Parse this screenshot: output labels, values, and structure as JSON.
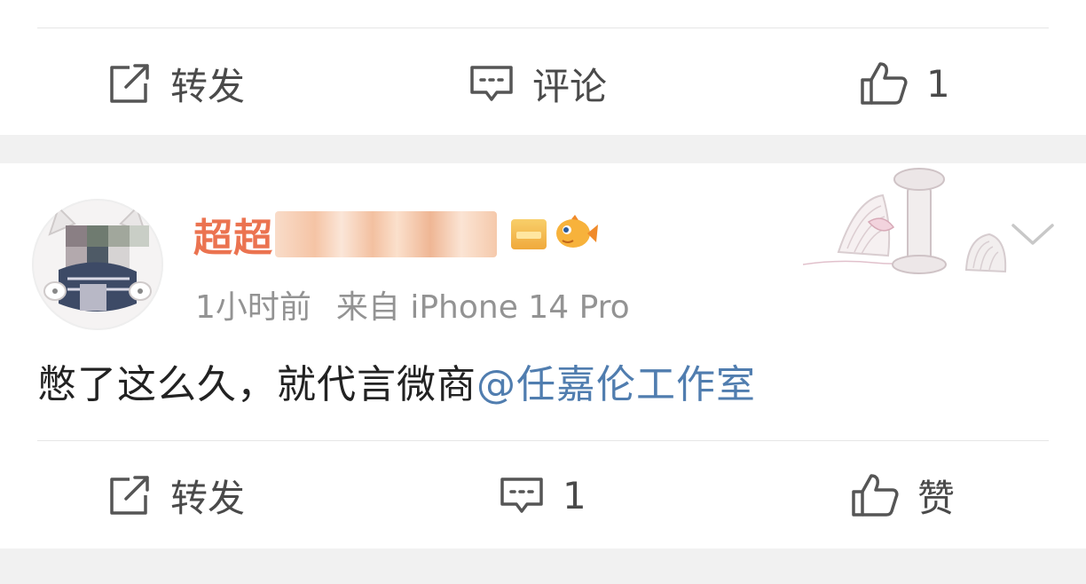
{
  "top_card": {
    "actions": {
      "repost_label": "转发",
      "comment_label": "评论",
      "like_count": "1"
    }
  },
  "post": {
    "username": "超超",
    "timestamp": "1小时前",
    "source": "来自 iPhone 14 Pro",
    "content_text": "憋了这么久，就代言微商",
    "mention": "@任嘉伦工作室",
    "actions": {
      "repost_label": "转发",
      "comment_count": "1",
      "like_label": "赞"
    }
  },
  "colors": {
    "username": "#eb7350",
    "mention": "#507daf",
    "meta": "#939393",
    "background": "#f1f1f1"
  },
  "icons": [
    "repost-icon",
    "comment-icon",
    "like-icon",
    "vip-badge-icon",
    "fish-badge-icon",
    "chevron-down-icon"
  ]
}
